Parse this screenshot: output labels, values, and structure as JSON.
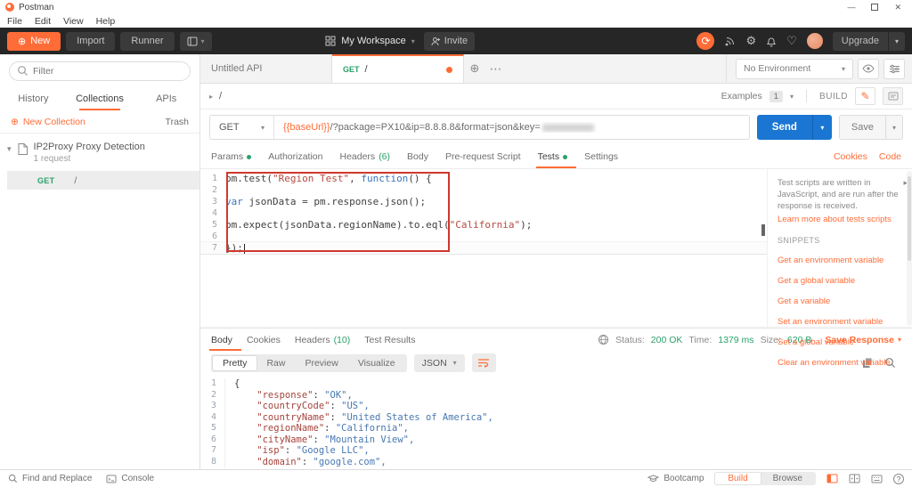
{
  "app": {
    "title": "Postman"
  },
  "menubar": {
    "items": [
      "File",
      "Edit",
      "View",
      "Help"
    ]
  },
  "toolbar": {
    "new_label": "New",
    "import_label": "Import",
    "runner_label": "Runner",
    "workspace_label": "My Workspace",
    "invite_label": "Invite",
    "upgrade_label": "Upgrade"
  },
  "sidebar": {
    "filter_placeholder": "Filter",
    "tabs": [
      {
        "label": "History"
      },
      {
        "label": "Collections"
      },
      {
        "label": "APIs"
      }
    ],
    "new_collection_label": "New Collection",
    "trash_label": "Trash",
    "collection": {
      "name": "IP2Proxy Proxy Detection",
      "meta": "1 request"
    },
    "request": {
      "method": "GET",
      "path": "/"
    }
  },
  "tabstrip": {
    "tab_untitled": "Untitled API",
    "tab_active_method": "GET",
    "tab_active_path": "/",
    "environment": "No Environment"
  },
  "subrow": {
    "breadcrumb": "/",
    "examples_label": "Examples",
    "examples_count": "1",
    "build_label": "BUILD"
  },
  "urlbar": {
    "method": "GET",
    "url_variable": "{{baseUrl}}",
    "url_rest": "/?package=PX10&ip=8.8.8.8&format=json&key=",
    "send_label": "Send",
    "save_label": "Save"
  },
  "request_tabs": {
    "items": [
      {
        "label": "Params"
      },
      {
        "label": "Authorization"
      },
      {
        "label": "Headers",
        "count": "(6)"
      },
      {
        "label": "Body"
      },
      {
        "label": "Pre-request Script"
      },
      {
        "label": "Tests"
      },
      {
        "label": "Settings"
      }
    ],
    "cookies_label": "Cookies",
    "code_label": "Code"
  },
  "tests_editor": {
    "cursor_line": 7,
    "lines": [
      {
        "segments": [
          [
            "pm.test(",
            "plain"
          ],
          [
            "\"Region Test\"",
            "string"
          ],
          [
            ", ",
            "plain"
          ],
          [
            "function",
            "keyword"
          ],
          [
            "() {",
            "plain"
          ]
        ]
      },
      {
        "segments": []
      },
      {
        "segments": [
          [
            "var",
            "keyword"
          ],
          [
            " jsonData = pm.response.json();",
            "plain"
          ]
        ]
      },
      {
        "segments": []
      },
      {
        "segments": [
          [
            "pm.expect(jsonData.regionName).to.eql(",
            "plain"
          ],
          [
            "\"California\"",
            "string"
          ],
          [
            ");",
            "plain"
          ]
        ]
      },
      {
        "segments": []
      },
      {
        "segments": [
          [
            "});",
            "plain"
          ]
        ]
      }
    ]
  },
  "help_panel": {
    "description": "Test scripts are written in JavaScript, and are run after the response is received.",
    "link": "Learn more about tests scripts",
    "snippets_title": "SNIPPETS",
    "snippets": [
      "Get an environment variable",
      "Get a global variable",
      "Get a variable",
      "Set an environment variable",
      "Set a global variable",
      "Clear an environment variable"
    ]
  },
  "response": {
    "tabs": [
      {
        "label": "Body"
      },
      {
        "label": "Cookies"
      },
      {
        "label": "Headers",
        "count": "(10)"
      },
      {
        "label": "Test Results"
      }
    ],
    "status_label": "Status:",
    "status_value": "200 OK",
    "time_label": "Time:",
    "time_value": "1379 ms",
    "size_label": "Size:",
    "size_value": "620 B",
    "save_label": "Save Response",
    "views": [
      "Pretty",
      "Raw",
      "Preview",
      "Visualize"
    ],
    "format": "JSON",
    "body_lines": [
      {
        "segments": [
          [
            "{",
            "plain"
          ]
        ]
      },
      {
        "segments": [
          [
            "    \"response\"",
            "key"
          ],
          [
            ": ",
            "plain"
          ],
          [
            "\"OK\",",
            "val"
          ]
        ]
      },
      {
        "segments": [
          [
            "    \"countryCode\"",
            "key"
          ],
          [
            ": ",
            "plain"
          ],
          [
            "\"US\",",
            "val"
          ]
        ]
      },
      {
        "segments": [
          [
            "    \"countryName\"",
            "key"
          ],
          [
            ": ",
            "plain"
          ],
          [
            "\"United States of America\",",
            "val"
          ]
        ]
      },
      {
        "segments": [
          [
            "    \"regionName\"",
            "key"
          ],
          [
            ": ",
            "plain"
          ],
          [
            "\"California\",",
            "val"
          ]
        ]
      },
      {
        "segments": [
          [
            "    \"cityName\"",
            "key"
          ],
          [
            ": ",
            "plain"
          ],
          [
            "\"Mountain View\",",
            "val"
          ]
        ]
      },
      {
        "segments": [
          [
            "    \"isp\"",
            "key"
          ],
          [
            ": ",
            "plain"
          ],
          [
            "\"Google LLC\",",
            "val"
          ]
        ]
      },
      {
        "segments": [
          [
            "    \"domain\"",
            "key"
          ],
          [
            ": ",
            "plain"
          ],
          [
            "\"google.com\",",
            "val"
          ]
        ]
      }
    ]
  },
  "footer": {
    "find_label": "Find and Replace",
    "console_label": "Console",
    "bootcamp_label": "Bootcamp",
    "build_label": "Build",
    "browse_label": "Browse"
  },
  "colors": {
    "accent": "#ff6c37",
    "green": "#2aa16a",
    "send_blue": "#1a76d2"
  }
}
